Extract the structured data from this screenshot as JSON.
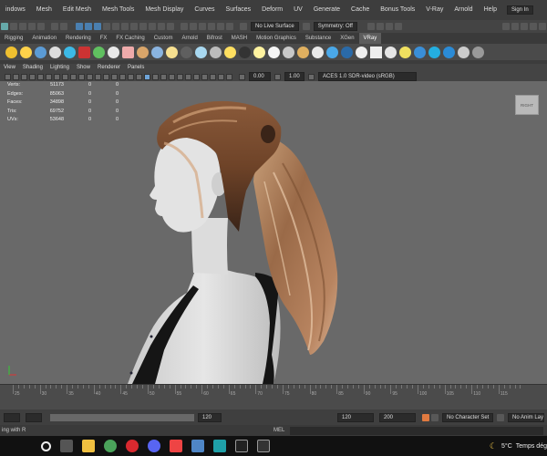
{
  "menubar": {
    "items": [
      "indows",
      "Mesh",
      "Edit Mesh",
      "Mesh Tools",
      "Mesh Display",
      "Curves",
      "Surfaces",
      "Deform",
      "UV",
      "Generate",
      "Cache",
      "Bonus Tools",
      "V-Ray",
      "Arnold",
      "Help"
    ],
    "workspace_icon": "workspace-icon",
    "sign_in_label": "Sign In"
  },
  "statusline": {
    "surface_label": "No Live Surface",
    "symmetry_label": "Symmetry: Off"
  },
  "shelf_tabs": {
    "items": [
      "Rigging",
      "Animation",
      "Rendering",
      "FX",
      "FX Caching",
      "Custom",
      "Arnold",
      "Bifrost",
      "MASH",
      "Motion Graphics",
      "Substance",
      "XGen",
      "VRay"
    ],
    "active_index": 12
  },
  "panel_menu": {
    "items": [
      "View",
      "Shading",
      "Lighting",
      "Show",
      "Renderer",
      "Panels"
    ]
  },
  "panel_toolbar": {
    "exposure_value": "0.00",
    "gamma_value": "1.00",
    "colorspace_label": "ACES 1.0 SDR-video (sRGB)"
  },
  "hud": {
    "rows": [
      {
        "label": "Verts:",
        "v1": "51173",
        "v2": "0",
        "v3": "0"
      },
      {
        "label": "Edges:",
        "v1": "85063",
        "v2": "0",
        "v3": "0"
      },
      {
        "label": "Faces:",
        "v1": "34898",
        "v2": "0",
        "v3": "0"
      },
      {
        "label": "Tris:",
        "v1": "69752",
        "v2": "0",
        "v3": "0"
      },
      {
        "label": "UVs:",
        "v1": "53648",
        "v2": "0",
        "v3": "0"
      }
    ]
  },
  "viewcube_label": "RIGHT",
  "timeslider": {
    "ticks": [
      "25",
      "30",
      "35",
      "40",
      "45",
      "50",
      "55",
      "60",
      "65",
      "70",
      "75",
      "80",
      "85",
      "90",
      "95",
      "100",
      "105",
      "110",
      "115"
    ]
  },
  "rangebar": {
    "range_end": "120",
    "end_value": "120",
    "total_value": "200",
    "character_set_label": "No Character Set",
    "anim_layer_label": "No Anim Layer"
  },
  "cmdline": {
    "left_text": "ing with R",
    "mel_label": "MEL"
  },
  "taskbar": {
    "temperature": "5°C",
    "weather_text": "Temps dég"
  },
  "colors": {
    "accent": "#5d9bd5",
    "viewport_bg": "#696969",
    "hair": "#b07850"
  }
}
